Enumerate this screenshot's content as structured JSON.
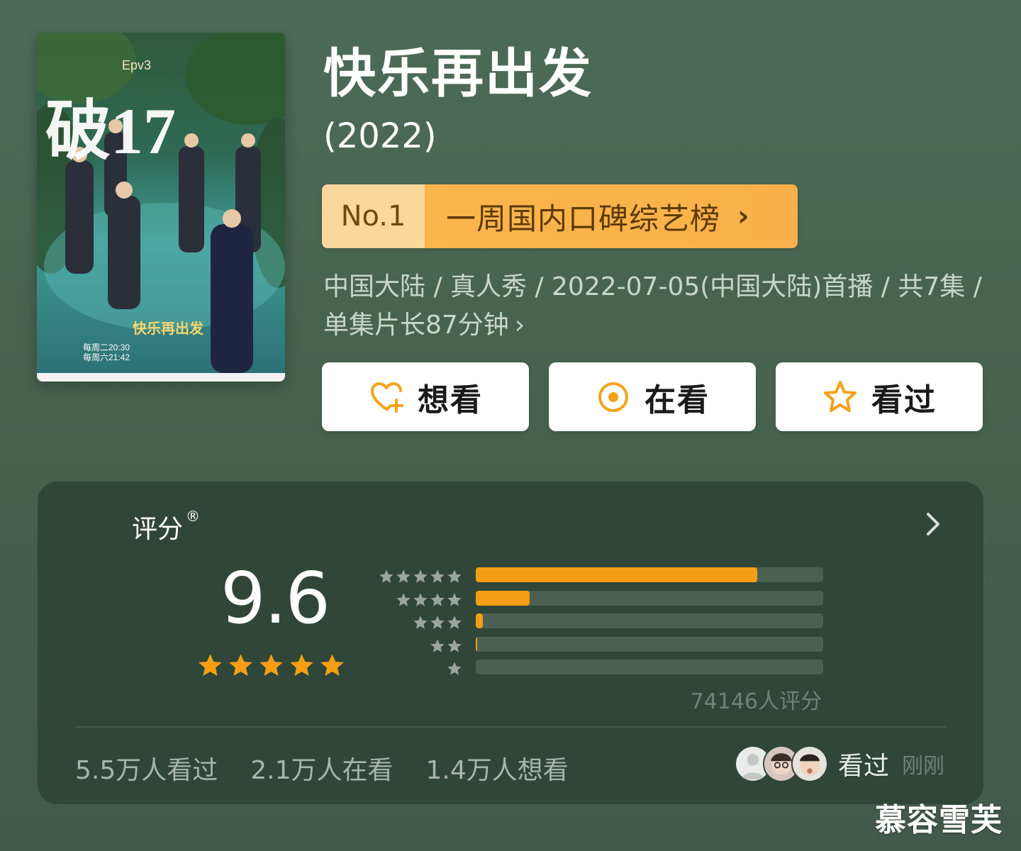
{
  "show": {
    "title": "快乐再出发",
    "year": "(2022)",
    "poster": {
      "subtitle_corner": "Epv3",
      "big_title": "破17",
      "logo": "快乐再出发",
      "schedule_line1": "每周二20:30",
      "schedule_line2": "每周六21:42"
    }
  },
  "rank": {
    "number": "No.1",
    "list_name": "一周国内口碑综艺榜",
    "chevron": "›"
  },
  "meta": {
    "text": "中国大陆 / 真人秀 / 2022-07-05(中国大陆)首播 / 共7集 / 单集片长87分钟",
    "chevron": "›"
  },
  "actions": [
    {
      "label": "想看",
      "icon": "heart-plus-icon"
    },
    {
      "label": "在看",
      "icon": "target-icon"
    },
    {
      "label": "看过",
      "icon": "star-outline-icon"
    }
  ],
  "rating": {
    "label": "评分",
    "trademark": "®",
    "score": "9.6",
    "stars_filled": 5,
    "distribution": [
      {
        "stars": 5,
        "fraction": 0.81
      },
      {
        "stars": 4,
        "fraction": 0.155
      },
      {
        "stars": 3,
        "fraction": 0.02
      },
      {
        "stars": 2,
        "fraction": 0.003
      },
      {
        "stars": 1,
        "fraction": 0.0
      }
    ],
    "count_text": "74146人评分"
  },
  "stats": {
    "watched": "5.5万人看过",
    "watching": "2.1万人在看",
    "want": "1.4万人想看"
  },
  "friends": {
    "action": "看过",
    "time": "刚刚"
  },
  "watermark": "慕容雪芙",
  "colors": {
    "accent": "#f59e14",
    "badge_light": "#fbd79b",
    "badge_dark": "#f9b04a",
    "card_bg": "#2f4639",
    "page_bg": "#47624f"
  }
}
